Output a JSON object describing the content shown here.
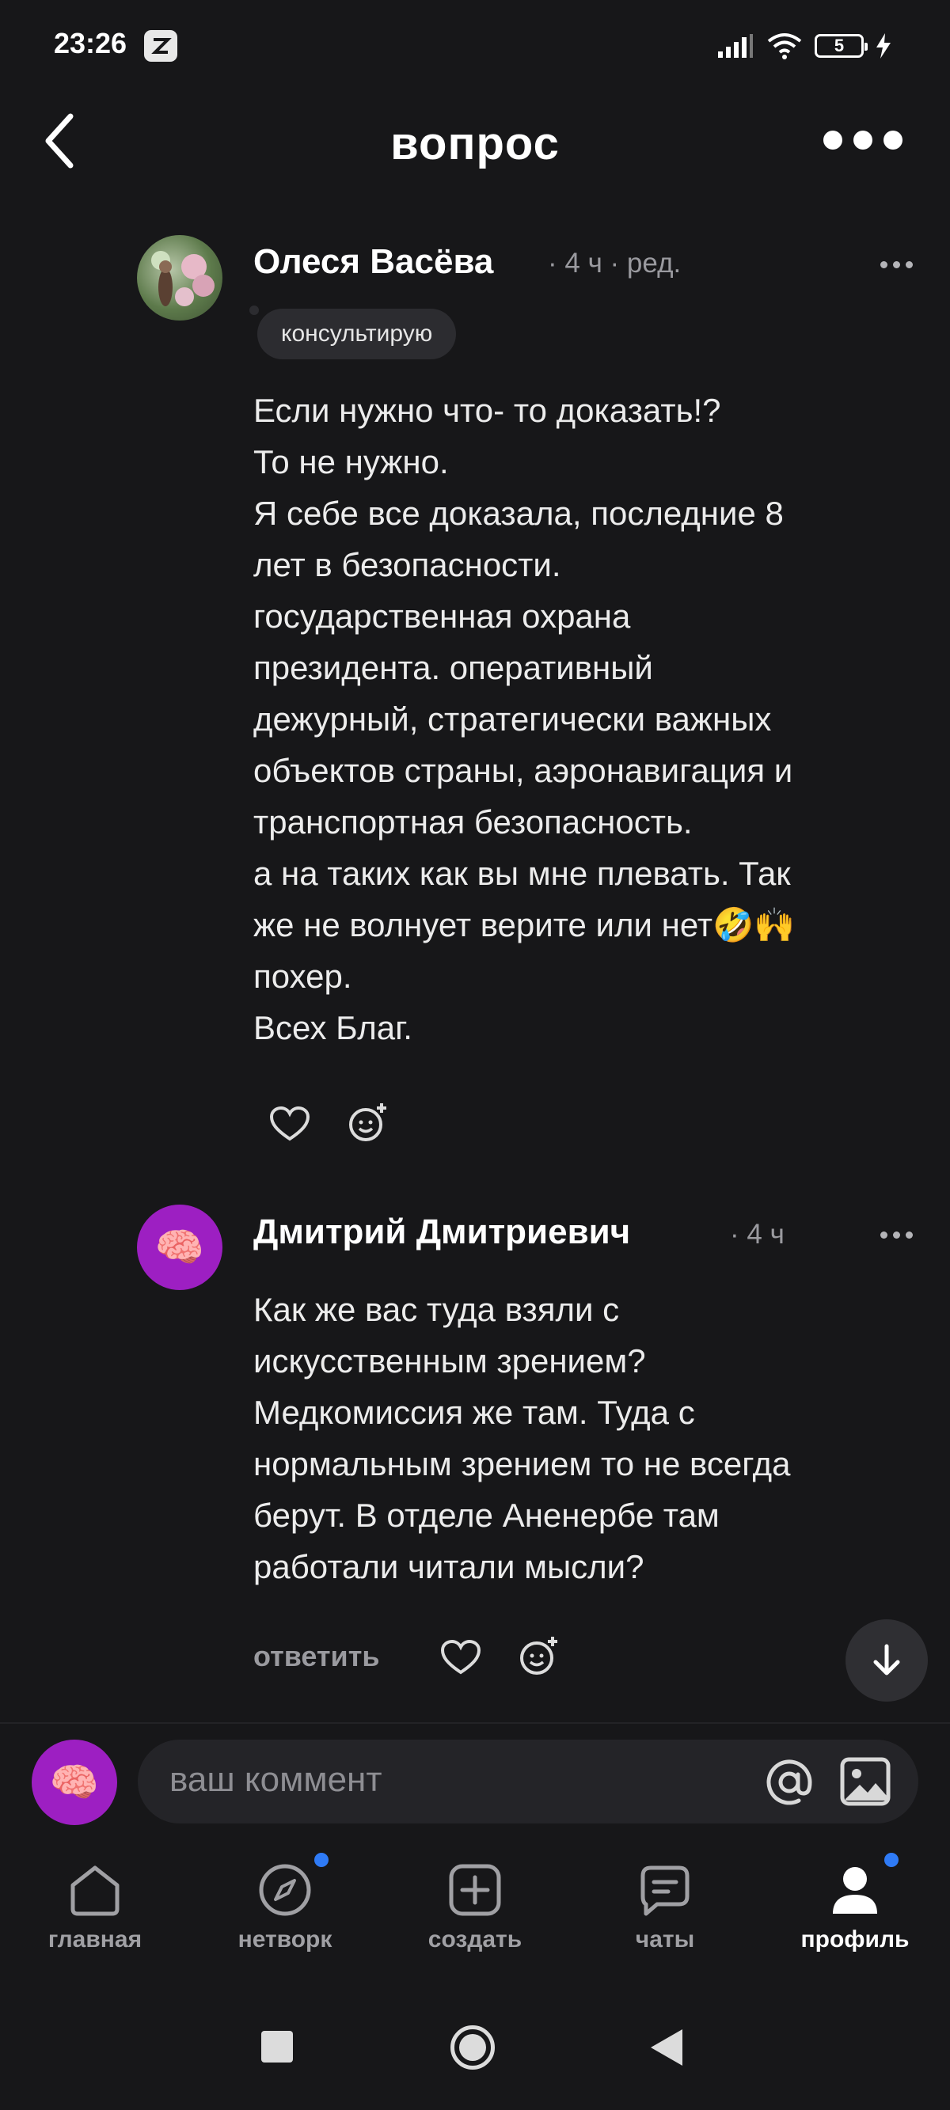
{
  "status_bar": {
    "time": "23:26",
    "battery": "5"
  },
  "header": {
    "title": "вопрос"
  },
  "comments": [
    {
      "author": "Олеся Васёва",
      "meta": "· 4 ч · ред.",
      "badge": "консультирую",
      "text": "Если нужно что- то доказать!?\nТо не нужно.\nЯ себе все доказала, последние 8\nлет в безопасности.\nгосударственная охрана\nпрезидента. оперативный\nдежурный, стратегически важных\nобъектов страны, аэронавигация и\nтранспортная безопасность.\nа на таких как вы мне плевать. Так\nже не волнует верите или нет🤣🙌\nпохер.\nВсех Благ."
    },
    {
      "author": "Дмитрий Дмитриевич",
      "meta": "· 4 ч",
      "avatar_emoji": "🧠",
      "text": "Как же вас туда взяли с\nискусственным зрением?\nМедкомиссия же там. Туда с\nнормальным зрением то не всегда\nберут. В отделе Аненербе там\nработали читали мысли?",
      "reply_label": "ответить"
    }
  ],
  "composer": {
    "placeholder": "ваш коммент",
    "avatar_emoji": "🧠"
  },
  "bottom_nav": [
    {
      "label": "главная",
      "icon": "home-icon"
    },
    {
      "label": "нетворк",
      "icon": "compass-icon",
      "dot": true
    },
    {
      "label": "создать",
      "icon": "plus-square-icon"
    },
    {
      "label": "чаты",
      "icon": "chat-icon"
    },
    {
      "label": "профиль",
      "icon": "profile-icon",
      "dot": true,
      "active": true
    }
  ],
  "colors": {
    "background": "#171719",
    "accent_dot": "#2f7bf6",
    "avatar_purple": "#9d1fc2"
  }
}
